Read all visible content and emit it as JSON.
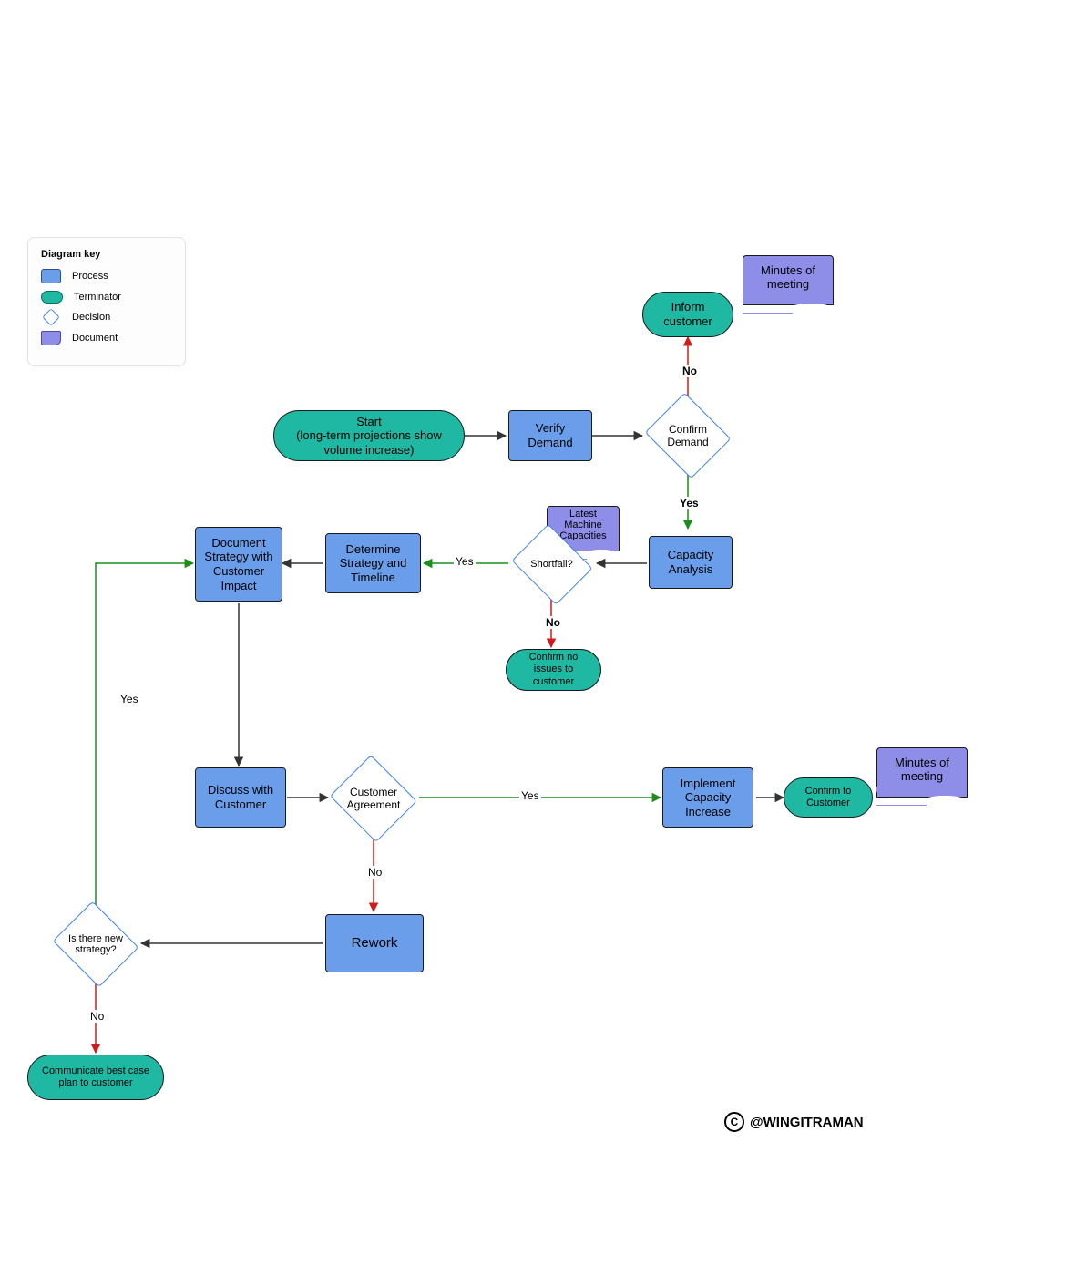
{
  "legend": {
    "title": "Diagram key",
    "items": [
      {
        "label": "Process"
      },
      {
        "label": "Terminator"
      },
      {
        "label": "Decision"
      },
      {
        "label": "Document"
      }
    ]
  },
  "colors": {
    "process": "#6b9eea",
    "terminator": "#1fb8a3",
    "decision_border": "#3b82f6",
    "document": "#8e8de8",
    "arrow_yes": "#1a8f1a",
    "arrow_no": "#d11a1a",
    "arrow_neutral": "#333333"
  },
  "nodes": {
    "start": {
      "type": "terminator",
      "text": "Start\n(long-term projections show volume increase)"
    },
    "verify_demand": {
      "type": "process",
      "text": "Verify Demand"
    },
    "confirm_demand": {
      "type": "decision",
      "text": "Confirm Demand"
    },
    "inform_customer": {
      "type": "terminator",
      "text": "Inform customer"
    },
    "minutes_top": {
      "type": "document",
      "text": "Minutes of meeting"
    },
    "capacity_analysis": {
      "type": "process",
      "text": "Capacity Analysis"
    },
    "latest_capacities": {
      "type": "document",
      "text": "Latest Machine Capacities"
    },
    "shortfall": {
      "type": "decision",
      "text": "Shortfall?"
    },
    "confirm_no_issues": {
      "type": "terminator",
      "text": "Confirm no issues to customer"
    },
    "determine_strategy": {
      "type": "process",
      "text": "Determine Strategy and Timeline"
    },
    "document_strategy": {
      "type": "process",
      "text": "Document Strategy with Customer Impact"
    },
    "discuss_customer": {
      "type": "process",
      "text": "Discuss with Customer"
    },
    "customer_agreement": {
      "type": "decision",
      "text": "Customer Agreement"
    },
    "implement_increase": {
      "type": "process",
      "text": "Implement Capacity Increase"
    },
    "confirm_to_customer": {
      "type": "terminator",
      "text": "Confirm to Customer"
    },
    "minutes_bottom": {
      "type": "document",
      "text": "Minutes of meeting"
    },
    "rework": {
      "type": "process",
      "text": "Rework"
    },
    "new_strategy": {
      "type": "decision",
      "text": "Is there new strategy?"
    },
    "communicate_plan": {
      "type": "terminator",
      "text": "Communicate best case plan to customer"
    }
  },
  "edge_labels": {
    "confirm_no": "No",
    "confirm_yes": "Yes",
    "shortfall_yes": "Yes",
    "shortfall_no": "No",
    "agreement_yes": "Yes",
    "agreement_no": "No",
    "newstrat_yes": "Yes",
    "newstrat_no": "No"
  },
  "watermark": "@WINGITRAMAN"
}
